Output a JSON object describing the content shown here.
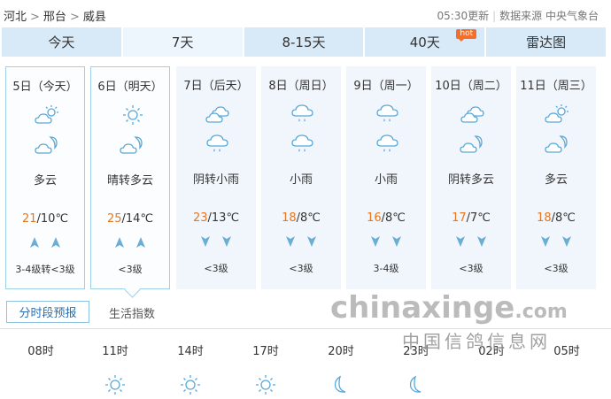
{
  "breadcrumb": {
    "province": "河北",
    "city": "邢台",
    "county": "威县",
    "sep": ">"
  },
  "meta": {
    "updated": "05:30更新",
    "source": "数据来源 中央气象台",
    "divider": "|"
  },
  "tabs": [
    {
      "label": "今天"
    },
    {
      "label": "7天"
    },
    {
      "label": "8-15天"
    },
    {
      "label": "40天",
      "badge": "hot"
    },
    {
      "label": "雷达图"
    }
  ],
  "colors": {
    "tab_bg": "#d8eaf8",
    "tab_active_bg": "#edf6fd",
    "card_bg": "#f0f6fc",
    "card_border": "#9fd0e6",
    "high_temp": "#e8761f",
    "arrow": "#6aaed6",
    "icon": "#5aa8d8",
    "hot_badge": "#f36f2b"
  },
  "days": [
    {
      "label": "5日（今天）",
      "icon_day": "partly-cloudy-icon",
      "icon_night": "partly-cloudy-night-icon",
      "weather": "多云",
      "high": "21",
      "low": "10",
      "unit": "℃",
      "wind_dir": "up",
      "wind": "3-4级转<3级"
    },
    {
      "label": "6日（明天）",
      "icon_day": "sunny-icon",
      "icon_night": "partly-cloudy-night-icon",
      "weather": "晴转多云",
      "high": "25",
      "low": "14",
      "unit": "℃",
      "wind_dir": "up",
      "wind": "<3级"
    },
    {
      "label": "7日（后天）",
      "icon_day": "overcast-icon",
      "icon_night": "light-rain-icon",
      "weather": "阴转小雨",
      "high": "23",
      "low": "13",
      "unit": "℃",
      "wind_dir": "down",
      "wind": "<3级"
    },
    {
      "label": "8日（周日）",
      "icon_day": "light-rain-icon",
      "icon_night": "light-rain-icon",
      "weather": "小雨",
      "high": "18",
      "low": "8",
      "unit": "℃",
      "wind_dir": "down",
      "wind": "<3级"
    },
    {
      "label": "9日（周一）",
      "icon_day": "light-rain-icon",
      "icon_night": "light-rain-icon",
      "weather": "小雨",
      "high": "16",
      "low": "8",
      "unit": "℃",
      "wind_dir": "down",
      "wind": "3-4级"
    },
    {
      "label": "10日（周二）",
      "icon_day": "overcast-icon",
      "icon_night": "partly-cloudy-night-icon",
      "weather": "阴转多云",
      "high": "17",
      "low": "7",
      "unit": "℃",
      "wind_dir": "down",
      "wind": "<3级"
    },
    {
      "label": "11日（周三）",
      "icon_day": "partly-cloudy-icon",
      "icon_night": "partly-cloudy-night-icon",
      "weather": "多云",
      "high": "18",
      "low": "8",
      "unit": "℃",
      "wind_dir": "down",
      "wind": "<3级"
    }
  ],
  "subtabs": [
    {
      "label": "分时段预报"
    },
    {
      "label": "生活指数"
    }
  ],
  "watermark": {
    "en_main": "chinaxinge",
    "en_tail": ".com",
    "cn": "中国信鸽信息网"
  },
  "hours": [
    {
      "time": "08时",
      "icon": ""
    },
    {
      "time": "11时",
      "icon": "sunny-icon"
    },
    {
      "time": "14时",
      "icon": "sunny-icon"
    },
    {
      "time": "17时",
      "icon": "sunny-icon"
    },
    {
      "time": "20时",
      "icon": "moon-icon"
    },
    {
      "time": "23时",
      "icon": "moon-icon"
    },
    {
      "time": "02时",
      "icon": ""
    },
    {
      "time": "05时",
      "icon": ""
    }
  ]
}
